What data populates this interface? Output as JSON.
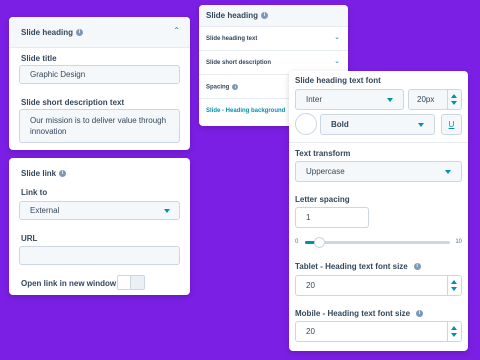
{
  "heading_panel": {
    "title": "Slide heading",
    "slide_title_label": "Slide title",
    "slide_title_value": "Graphic Design",
    "short_desc_label": "Slide short description text",
    "short_desc_value": "Our mission is to deliver value through innovation"
  },
  "link_panel": {
    "title": "Slide link",
    "link_to_label": "Link to",
    "link_to_value": "External",
    "url_label": "URL",
    "url_value": "",
    "open_new_window_label": "Open link in new window",
    "open_new_window_on": false
  },
  "style_panel": {
    "title": "Slide heading",
    "rows": [
      {
        "label": "Slide heading text"
      },
      {
        "label": "Slide short description"
      },
      {
        "label": "Spacing"
      },
      {
        "label": "Slide - Heading background"
      }
    ]
  },
  "font_panel": {
    "font_label": "Slide heading text font",
    "font_family": "Inter",
    "font_size": "20px",
    "font_weight": "Bold",
    "underline_glyph": "U",
    "text_transform_label": "Text transform",
    "text_transform_value": "Uppercase",
    "letter_spacing_label": "Letter spacing",
    "letter_spacing_value": "1",
    "slider_min": "0",
    "slider_max": "10",
    "slider_value": 1,
    "tablet_label": "Tablet - Heading text font size",
    "tablet_value": "20",
    "mobile_label": "Mobile - Heading text font size",
    "mobile_value": "20"
  },
  "colors": {
    "background": "#7b1fe4",
    "accent": "#0091ae",
    "text": "#33475b"
  }
}
